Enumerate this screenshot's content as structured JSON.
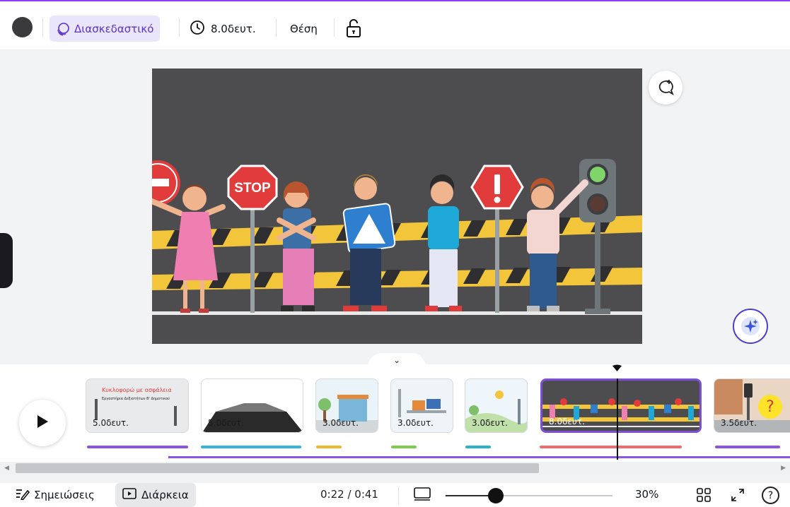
{
  "toolbar": {
    "color_swatch": "#3a3a3d",
    "animation_label": "Διασκεδαστικό",
    "duration_label": "8.0δευτ.",
    "position_label": "Θέση",
    "lock_icon": "unlock-icon",
    "accent_color": "#8b3dff"
  },
  "canvas": {
    "background": "#4d4d4f",
    "stop_sign_text": "STOP",
    "comment_icon": "add-comment-icon",
    "magic_icon": "sparkle-icon"
  },
  "timeline": {
    "collapse_icon": "chevron-down-icon",
    "play_icon": "play-icon",
    "clips": [
      {
        "duration": "5.0δευτ.",
        "title": "Κυκλοφορώ με ασφάλεια",
        "subtitle": "Εργαστήρια Δεξιοτήτων Β' Δημοτικού",
        "bar_color": "#8b55e0"
      },
      {
        "duration": "5.0δευτ.",
        "bar_color": "#35b4e0"
      },
      {
        "duration": "3.0δευτ.",
        "bar_color": "#f1b72e"
      },
      {
        "duration": "3.0δευτ.",
        "bar_color": "#7ccd4d"
      },
      {
        "duration": "3.0δευτ.",
        "bar_color": "#2ab3c6"
      },
      {
        "duration": "8.0δευτ.",
        "bar_color": "#ef6b6b",
        "selected": true
      },
      {
        "duration": "3.5δευτ.",
        "bar_color": "#8b55e0",
        "help_text": "?"
      }
    ]
  },
  "footer": {
    "notes_label": "Σημειώσεις",
    "duration_tab_label": "Διάρκεια",
    "time_current": "0:22",
    "time_total": "0:41",
    "time_readout": "0:22 / 0:41",
    "zoom_percent": "30%",
    "zoom_value": 0.3,
    "help_label": "?"
  }
}
